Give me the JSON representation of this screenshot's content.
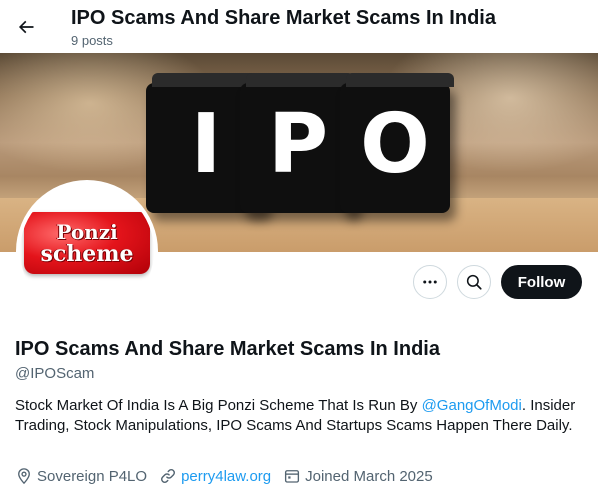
{
  "header": {
    "title": "IPO Scams And Share Market Scams In India",
    "posts": "9 posts"
  },
  "banner": {
    "letters": [
      "I",
      "P",
      "O"
    ]
  },
  "avatar": {
    "line1": "Ponzi",
    "line2": "scheme"
  },
  "actions": {
    "follow_label": "Follow"
  },
  "profile": {
    "name": "IPO Scams And Share Market Scams In India",
    "handle": "@IPOScam",
    "bio_before": "Stock Market Of India Is A Big Ponzi Scheme That Is Run By ",
    "bio_mention": "@GangOfModi",
    "bio_after": ". Insider Trading, Stock Manipulations, IPO Scams And Startups Scams Happen There Daily.",
    "location": "Sovereign P4LO",
    "website": "perry4law.org",
    "joined": "Joined March 2025"
  },
  "colors": {
    "accent": "#1d9bf0",
    "text": "#0f1419",
    "secondary": "#536471",
    "button": "#0f1419"
  },
  "icons": [
    "back-arrow-icon",
    "more-icon",
    "search-icon",
    "location-icon",
    "link-icon",
    "calendar-icon"
  ]
}
